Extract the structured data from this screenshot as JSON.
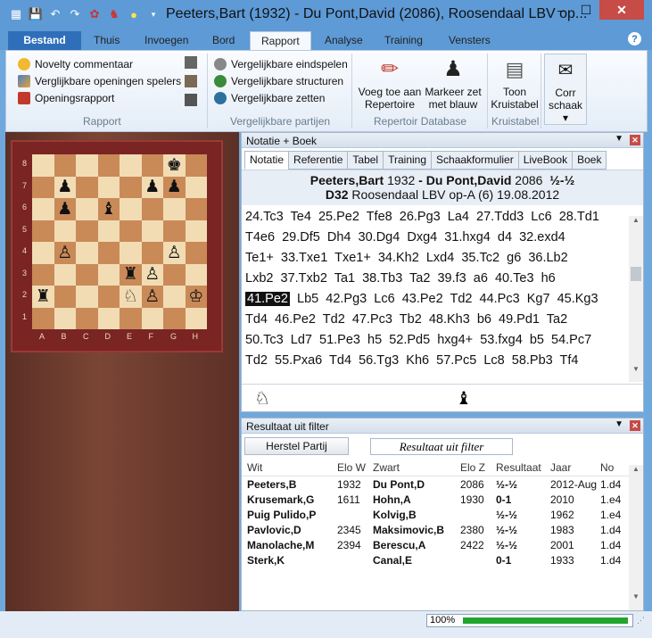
{
  "window": {
    "title": "Peeters,Bart (1932) - Du Pont,David (2086), Roosendaal LBV op...",
    "help_glyph": "?"
  },
  "quick_access": [
    "board-icon",
    "save-icon",
    "undo-icon",
    "redo-icon",
    "settings-icon",
    "engine-icon",
    "bulb-icon",
    "dropdown-icon"
  ],
  "ribbon_tabs": [
    "Bestand",
    "Thuis",
    "Invoegen",
    "Bord",
    "Rapport",
    "Analyse",
    "Training",
    "Vensters"
  ],
  "active_tab": "Rapport",
  "ribbon": {
    "rapport_items": [
      "Novelty commentaar",
      "Verglijkbare openingen spelers",
      "Openingsrapport"
    ],
    "rapport_label": "Rapport",
    "vergelijk_items": [
      "Vergelijkbare eindspelen",
      "Vergelijkbare structuren",
      "Vergelijkbare zetten"
    ],
    "vergelijk_label": "Vergelijkbare partijen",
    "rep_btn1": [
      "Voeg toe aan",
      "Repertoire"
    ],
    "rep_btn2": [
      "Markeer zet",
      "met blauw"
    ],
    "rep_label": "Repertoir Database",
    "kruis_btn": [
      "Toon",
      "Kruistabel"
    ],
    "kruis_label": "Kruistabel",
    "corr_btn": [
      "Corr",
      "schaak"
    ]
  },
  "board": {
    "ranks": [
      "8",
      "7",
      "6",
      "5",
      "4",
      "3",
      "2",
      "1"
    ],
    "files": [
      "A",
      "B",
      "C",
      "D",
      "E",
      "F",
      "G",
      "H"
    ],
    "position": [
      [
        "",
        "",
        "",
        "",
        "",
        "",
        "♚",
        ""
      ],
      [
        "",
        "♟",
        "",
        "",
        "",
        "♟",
        "♟",
        ""
      ],
      [
        "",
        "♟",
        "",
        "♝",
        "",
        "",
        "",
        ""
      ],
      [
        "",
        "",
        "",
        "",
        "",
        "",
        "",
        ""
      ],
      [
        "",
        "♙",
        "",
        "",
        "",
        "",
        "♙",
        ""
      ],
      [
        "",
        "",
        "",
        "",
        "♜",
        "♙",
        "",
        ""
      ],
      [
        "♜",
        "",
        "",
        "",
        "♘",
        "♙",
        "",
        "♔"
      ],
      [
        "",
        "",
        "",
        "",
        "",
        "",
        "",
        ""
      ]
    ]
  },
  "notation_panel": {
    "title": "Notatie + Boek",
    "tabs": [
      "Notatie",
      "Referentie",
      "Tabel",
      "Training",
      "Schaakformulier",
      "LiveBook",
      "Boek"
    ],
    "active_tab": "Notatie",
    "white": "Peeters,Bart",
    "white_elo": "1932",
    "sep": "-",
    "black": "Du Pont,David",
    "black_elo": "2086",
    "result": "½-½",
    "eco": "D32",
    "event": "Roosendaal LBV op-A (6) 19.08.2012",
    "moves_lines": [
      "24.Tc3  Te4  25.Pe2  Tfe8  26.Pg3  La4  27.Tdd3  Lc6  28.Td1",
      "T4e6  29.Df5  Dh4  30.Dg4  Dxg4  31.hxg4  d4  32.exd4",
      "Te1+  33.Txe1  Txe1+  34.Kh2  Lxd4  35.Tc2  g6  36.Lb2",
      "Lxb2  37.Txb2  Ta1  38.Tb3  Ta2  39.f3  a6  40.Te3  h6",
      "@41.Pe2@  Lb5  42.Pg3  Lc6  43.Pe2  Td2  44.Pc3  Kg7  45.Kg3",
      "Td4  46.Pe2  Td2  47.Pc3  Tb2  48.Kh3  b6  49.Pd1  Ta2",
      "50.Tc3  Ld7  51.Pe3  h5  52.Pd5  hxg4+  53.fxg4  b5  54.Pc7",
      "Td2  55.Pxa6  Td4  56.Tg3  Kh6  57.Pc5  Lc8  58.Pb3  Tf4"
    ]
  },
  "filter_panel": {
    "title": "Resultaat uit filter",
    "herstel_button": "Herstel Partij",
    "filter_label": "Resultaat uit filter",
    "columns": [
      "Wit",
      "Elo W",
      "Zwart",
      "Elo Z",
      "Resultaat",
      "Jaar",
      "No"
    ],
    "rows": [
      [
        "Peeters,B",
        "1932",
        "Du Pont,D",
        "2086",
        "½-½",
        "2012-Aug",
        "1.d4"
      ],
      [
        "Krusemark,G",
        "1611",
        "Hohn,A",
        "1930",
        "0-1",
        "2010",
        "1.e4"
      ],
      [
        "Puig Pulido,P",
        "",
        "Kolvig,B",
        "",
        "½-½",
        "1962",
        "1.e4"
      ],
      [
        "Pavlovic,D",
        "2345",
        "Maksimovic,B",
        "2380",
        "½-½",
        "1983",
        "1.d4"
      ],
      [
        "Manolache,M",
        "2394",
        "Berescu,A",
        "2422",
        "½-½",
        "2001",
        "1.d4"
      ],
      [
        "Sterk,K",
        "",
        "Canal,E",
        "",
        "0-1",
        "1933",
        "1.d4"
      ]
    ]
  },
  "status": {
    "zoom": "100%"
  },
  "progress": 1.0,
  "colors": {
    "accent": "#5d9ad6",
    "file_tab": "#2f6fba",
    "close": "#c74b47",
    "progress": "#21a52f"
  }
}
